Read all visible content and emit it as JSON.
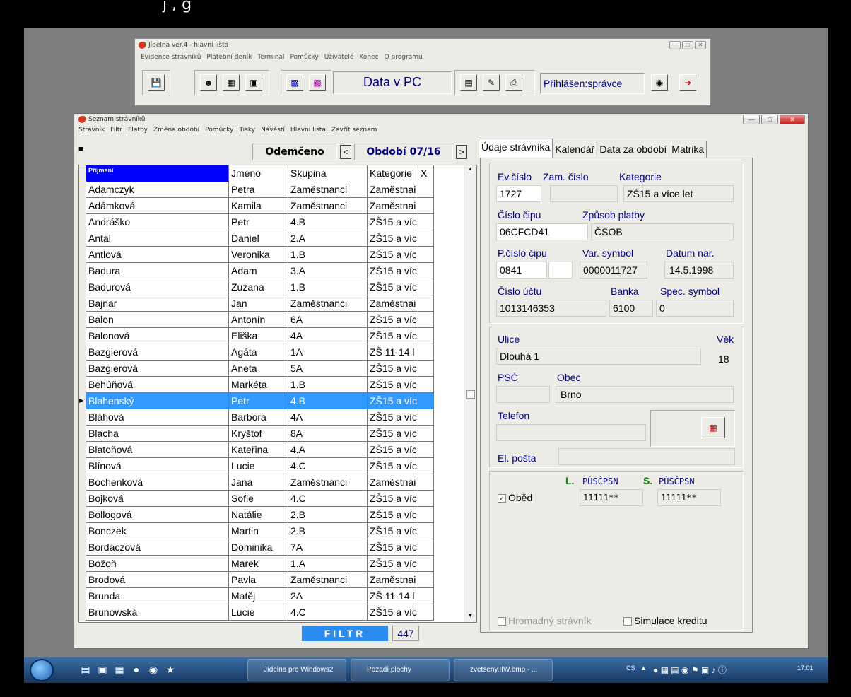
{
  "caption_partial": "j                   ,                     g",
  "mainbar": {
    "title": "Jídelna ver.4 - hlavní lišta",
    "menu": [
      "Evidence strávníků",
      "Platební deník",
      "Terminál",
      "Pomůcky",
      "Uživatelé",
      "Konec",
      "O programu"
    ],
    "status": "Data v PC",
    "login": "Přihlášen:správce"
  },
  "seznam": {
    "title": "Seznam strávníků",
    "menu": [
      "Strávník",
      "Filtr",
      "Platby",
      "Změna období",
      "Pomůcky",
      "Tisky",
      "Návěští",
      "Hlavní lišta",
      "Zavřít seznam"
    ],
    "lock_status": "Odemčeno",
    "period": "Období 07/16",
    "prev": "<",
    "next": ">",
    "columns": [
      "Příjmení",
      "Jméno",
      "Skupina",
      "Kategorie",
      "X"
    ],
    "rows": [
      [
        "Adamczyk",
        "Petra",
        "Zaměstnanci",
        "Zaměstnai"
      ],
      [
        "Adámková",
        "Kamila",
        "Zaměstnanci",
        "Zaměstnai"
      ],
      [
        "Andráško",
        "Petr",
        "4.B",
        "ZŠ15 a víc"
      ],
      [
        "Antal",
        "Daniel",
        "2.A",
        "ZŠ15 a víc"
      ],
      [
        "Antlová",
        "Veronika",
        "1.B",
        "ZŠ15 a víc"
      ],
      [
        "Badura",
        "Adam",
        "3.A",
        "ZŠ15 a víc"
      ],
      [
        "Badurová",
        "Zuzana",
        "1.B",
        "ZŠ15 a víc"
      ],
      [
        "Bajnar",
        "Jan",
        "Zaměstnanci",
        "Zaměstnai"
      ],
      [
        "Balon",
        "Antonín",
        "6A",
        "ZŠ15 a víc"
      ],
      [
        "Balonová",
        "Eliška",
        "4A",
        "ZŠ15 a víc"
      ],
      [
        "Bazgierová",
        "Agáta",
        "1A",
        "ZŠ 11-14 l"
      ],
      [
        "Bazgierová",
        "Aneta",
        "5A",
        "ZŠ15 a víc"
      ],
      [
        "Behúňová",
        "Markéta",
        "1.B",
        "ZŠ15 a víc"
      ],
      [
        "Blahenský",
        "Petr",
        "4.B",
        "ZŠ15 a víc"
      ],
      [
        "Bláhová",
        "Barbora",
        "4A",
        "ZŠ15 a víc"
      ],
      [
        "Blacha",
        "Kryštof",
        "8A",
        "ZŠ15 a víc"
      ],
      [
        "Blatoňová",
        "Kateřina",
        "4.A",
        "ZŠ15 a víc"
      ],
      [
        "Blínová",
        "Lucie",
        "4.C",
        "ZŠ15 a víc"
      ],
      [
        "Bochenková",
        "Jana",
        "Zaměstnanci",
        "Zaměstnai"
      ],
      [
        "Bojková",
        "Sofie",
        "4.C",
        "ZŠ15 a víc"
      ],
      [
        "Bollogová",
        "Natálie",
        "2.B",
        "ZŠ15 a víc"
      ],
      [
        "Bonczek",
        "Martin",
        "2.B",
        "ZŠ15 a víc"
      ],
      [
        "Bordáczová",
        "Dominika",
        "7A",
        "ZŠ15 a víc"
      ],
      [
        "Božoň",
        "Marek",
        "1.A",
        "ZŠ15 a víc"
      ],
      [
        "Brodová",
        "Pavla",
        "Zaměstnanci",
        "Zaměstnai"
      ],
      [
        "Brunda",
        "Matěj",
        "2A",
        "ZŠ 11-14 l"
      ],
      [
        "Brunowská",
        "Lucie",
        "4.C",
        "ZŠ15 a víc"
      ]
    ],
    "selected_index": 13,
    "filter_label": "FILTR",
    "count": "447"
  },
  "detail": {
    "tabs": [
      "Údaje strávníka",
      "Kalendář",
      "Data za období",
      "Matrika"
    ],
    "ev_cislo_label": "Ev.číslo",
    "ev_cislo": "1727",
    "zam_cislo_label": "Zam. číslo",
    "zam_cislo": "",
    "kategorie_label": "Kategorie",
    "kategorie": "ZŠ15 a více let",
    "cislo_cipu_label": "Číslo čipu",
    "cislo_cipu": "06CFCD41",
    "zpusob_platby_label": "Způsob platby",
    "zpusob_platby": "ČSOB",
    "p_cislo_cipu_label": "P.číslo čipu",
    "p_cislo_cipu": "0841",
    "var_symbol_label": "Var. symbol",
    "var_symbol": "0000011727",
    "datum_nar_label": "Datum nar.",
    "datum_nar": "14.5.1998",
    "cislo_uctu_label": "Číslo účtu",
    "cislo_uctu": "1013146353",
    "banka_label": "Banka",
    "banka": "6100",
    "spec_symbol_label": "Spec. symbol",
    "spec_symbol": "0",
    "ulice_label": "Ulice",
    "ulice": "Dlouhá 1",
    "vek_label": "Věk",
    "vek": "18",
    "psc_label": "PSČ",
    "psc": "",
    "obec_label": "Obec",
    "obec": "Brno",
    "telefon_label": "Telefon",
    "telefon": "",
    "email_label": "El. pošta",
    "email": "",
    "l_label": "L.",
    "s_label": "S.",
    "days_header": "PÚSČPSN",
    "obed_label": "Oběd",
    "obed_l": "11111**",
    "obed_s": "11111**",
    "hromadny_label": "Hromadný strávník",
    "simulace_label": "Simulace kreditu"
  },
  "taskbar": {
    "tasks": [
      "Jídelna pro Windows2",
      "Pozadí plochy",
      "zvetseny.IIW.bmp - ..."
    ],
    "lang": "CS",
    "time": "17:01"
  }
}
